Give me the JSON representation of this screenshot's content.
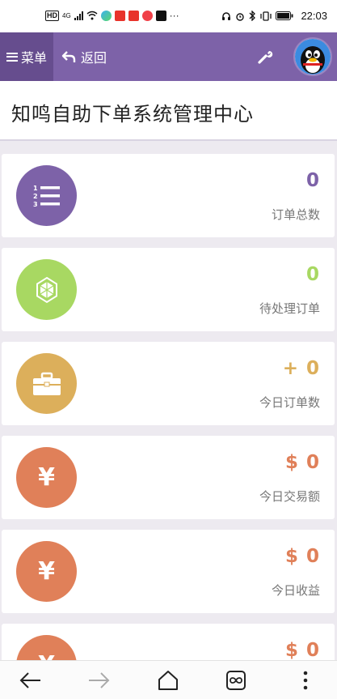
{
  "statusbar": {
    "time": "22:03",
    "network": "4G"
  },
  "header": {
    "menu_label": "菜单",
    "back_label": "返回"
  },
  "page": {
    "title": "知鸣自助下单系统管理中心"
  },
  "colors": {
    "purple": "#7d62a8",
    "green": "#a8d862",
    "gold": "#dcaf5b",
    "orange": "#e08059"
  },
  "cards": [
    {
      "value": "0",
      "label": "订单总数",
      "color": "#7d62a8",
      "icon": "numbered-list-icon"
    },
    {
      "value": "0",
      "label": "待处理订单",
      "color": "#a8d862",
      "icon": "snowflake-icon"
    },
    {
      "value": "+ 0",
      "label": "今日订单数",
      "color": "#dcaf5b",
      "icon": "briefcase-icon"
    },
    {
      "value": "$ 0",
      "label": "今日交易额",
      "color": "#e08059",
      "icon": "yen-icon"
    },
    {
      "value": "$ 0",
      "label": "今日收益",
      "color": "#e08059",
      "icon": "yen-icon"
    },
    {
      "value": "$ 0",
      "label": "",
      "color": "#e08059",
      "icon": "yen-icon"
    }
  ],
  "icons": {
    "yen_glyph": "¥"
  }
}
